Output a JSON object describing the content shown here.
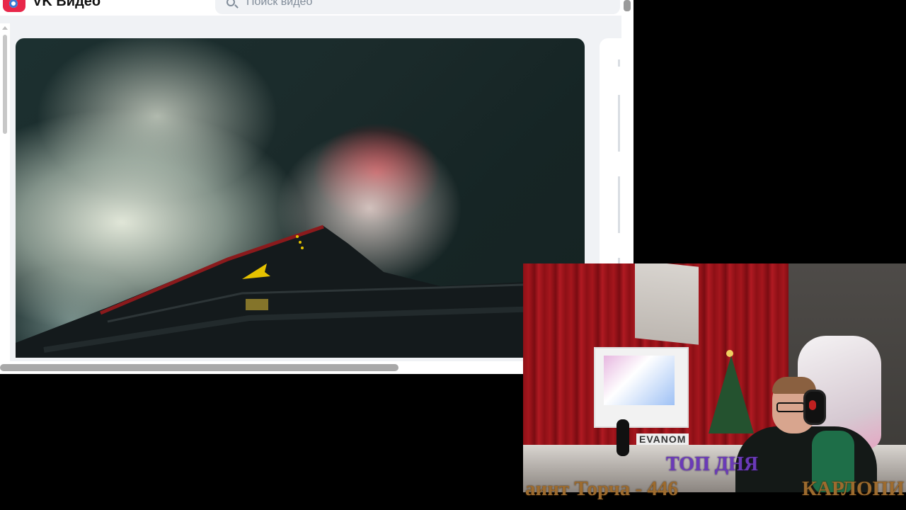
{
  "browser": {
    "brand": "VK Видео",
    "search": {
      "placeholder": "Поиск видео"
    }
  },
  "video": {
    "accent_color": "#e6c200"
  },
  "overlay": {
    "top_day_label": "ТОП ДНЯ",
    "ticker_left": "аинт Торча - 446",
    "ticker_right": "КАРЛОПИ",
    "computer_brand": "EVANOM"
  }
}
